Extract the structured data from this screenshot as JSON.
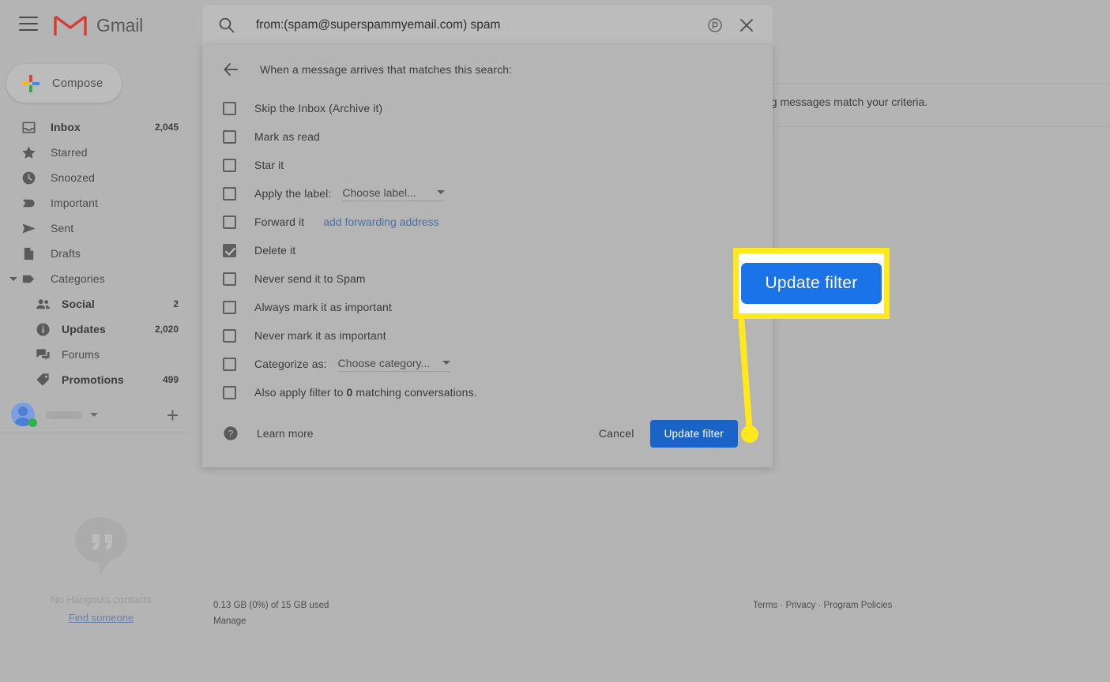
{
  "app": {
    "brand": "Gmail",
    "menu_icon": "hamburger-icon",
    "logo_icon": "gmail-m-logo"
  },
  "compose": {
    "label": "Compose",
    "icon": "plus-icon"
  },
  "sidebar": {
    "items": [
      {
        "label": "Inbox",
        "count": "2,045",
        "icon": "inbox-icon",
        "bold": true,
        "sub": false
      },
      {
        "label": "Starred",
        "count": "",
        "icon": "star-icon",
        "bold": false,
        "sub": false
      },
      {
        "label": "Snoozed",
        "count": "",
        "icon": "clock-icon",
        "bold": false,
        "sub": false
      },
      {
        "label": "Important",
        "count": "",
        "icon": "important-icon",
        "bold": false,
        "sub": false
      },
      {
        "label": "Sent",
        "count": "",
        "icon": "send-icon",
        "bold": false,
        "sub": false
      },
      {
        "label": "Drafts",
        "count": "",
        "icon": "draft-icon",
        "bold": false,
        "sub": false
      },
      {
        "label": "Categories",
        "count": "",
        "icon": "label-icon",
        "bold": false,
        "sub": false
      },
      {
        "label": "Social",
        "count": "2",
        "icon": "people-icon",
        "bold": true,
        "sub": true
      },
      {
        "label": "Updates",
        "count": "2,020",
        "icon": "info-icon",
        "bold": true,
        "sub": true
      },
      {
        "label": "Forums",
        "count": "",
        "icon": "forum-icon",
        "bold": false,
        "sub": true
      },
      {
        "label": "Promotions",
        "count": "499",
        "icon": "tag-icon",
        "bold": true,
        "sub": true
      }
    ]
  },
  "hangouts": {
    "empty_text": "No Hangouts contacts",
    "find_link": "Find someone",
    "add_icon": "plus-icon",
    "avatar_icon": "avatar-icon",
    "bubble_icon": "hangouts-bubble-icon"
  },
  "search": {
    "query": "from:(spam@superspammyemail.com) spam",
    "search_icon": "search-icon",
    "options_icon": "search-options-icon",
    "close_icon": "close-icon"
  },
  "background": {
    "criteria_text": "ting messages match your criteria."
  },
  "dialog": {
    "back_icon": "back-arrow-icon",
    "heading": "When a message arrives that matches this search:",
    "options": [
      {
        "label": "Skip the Inbox (Archive it)",
        "checked": false,
        "type": "plain"
      },
      {
        "label": "Mark as read",
        "checked": false,
        "type": "plain"
      },
      {
        "label": "Star it",
        "checked": false,
        "type": "plain"
      },
      {
        "label": "Apply the label:",
        "checked": false,
        "type": "select",
        "select_value": "Choose label..."
      },
      {
        "label": "Forward it",
        "checked": false,
        "type": "link",
        "link_text": "add forwarding address"
      },
      {
        "label": "Delete it",
        "checked": true,
        "type": "plain"
      },
      {
        "label": "Never send it to Spam",
        "checked": false,
        "type": "plain"
      },
      {
        "label": "Always mark it as important",
        "checked": false,
        "type": "plain"
      },
      {
        "label": "Never mark it as important",
        "checked": false,
        "type": "plain"
      },
      {
        "label": "Categorize as:",
        "checked": false,
        "type": "select",
        "select_value": "Choose category..."
      },
      {
        "label": "Also apply filter to",
        "checked": false,
        "type": "count",
        "count": "0",
        "label_tail": "matching conversations."
      }
    ],
    "help_icon": "help-circle-icon",
    "learn_more": "Learn more",
    "cancel_label": "Cancel",
    "update_label": "Update filter"
  },
  "callout": {
    "button_label": "Update filter",
    "highlight_color": "#ffe81c",
    "button_color": "#1a73e8"
  },
  "footer": {
    "storage": "0.13 GB (0%) of 15 GB used",
    "manage": "Manage",
    "terms": "Terms",
    "privacy": "Privacy",
    "policies": "Program Policies",
    "separator": " · "
  }
}
